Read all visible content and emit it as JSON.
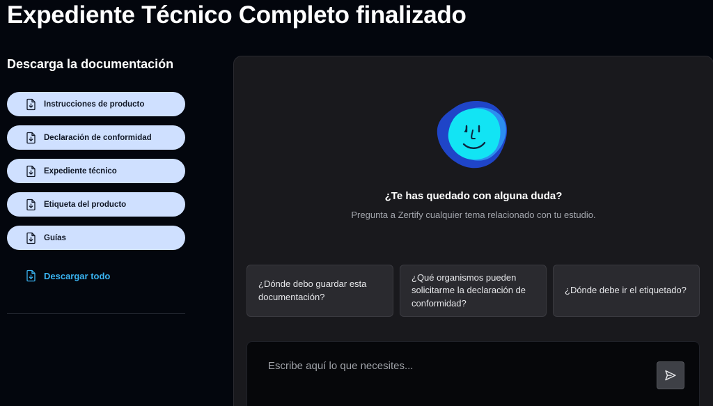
{
  "page": {
    "title": "Expediente Técnico Completo finalizado"
  },
  "sidebar": {
    "heading": "Descarga la documentación",
    "documents": [
      {
        "label": "Instrucciones de producto",
        "icon": "file-download-icon"
      },
      {
        "label": "Declaración de conformidad",
        "icon": "file-download-icon"
      },
      {
        "label": "Expediente técnico",
        "icon": "file-download-icon"
      },
      {
        "label": "Etiqueta del producto",
        "icon": "file-download-icon"
      },
      {
        "label": "Guías",
        "icon": "file-download-icon"
      }
    ],
    "download_all": {
      "label": "Descargar todo",
      "icon": "file-download-icon"
    }
  },
  "chat": {
    "avatar_icon": "assistant-face-icon",
    "heading": "¿Te has quedado con alguna duda?",
    "subheading": "Pregunta a Zertify cualquier tema relacionado con tu estudio.",
    "suggestions": [
      "¿Dónde debo guardar esta documentación?",
      "¿Qué organismos pueden solicitarme la declaración de conformidad?",
      "¿Dónde debe ir el etiquetado?"
    ],
    "input": {
      "placeholder": "Escribe aquí lo que necesites...",
      "value": ""
    },
    "send_icon": "send-icon"
  },
  "colors": {
    "background": "#03060d",
    "doc_button": "#cfe0ff",
    "accent": "#3ab4f2",
    "panel": "#19191d"
  }
}
